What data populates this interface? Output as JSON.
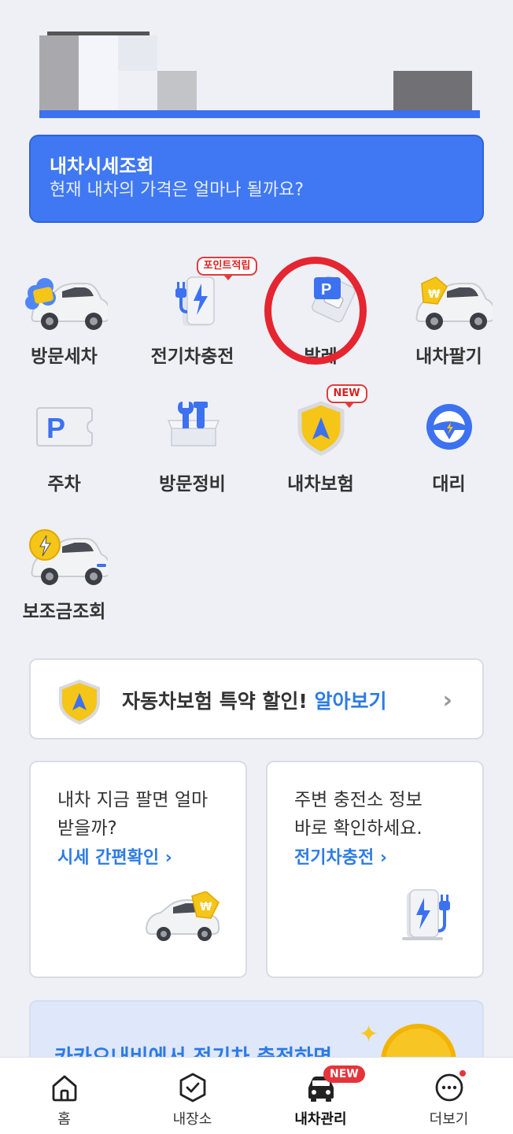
{
  "colors": {
    "accent": "#3f78f2",
    "link": "#2d7be5",
    "badge_red": "#e23b3b",
    "highlight_circle": "#e52530"
  },
  "banner": {
    "title": "내차시세조회",
    "subtitle": "현재 내차의 가격은 얼마나 될까요?"
  },
  "services": [
    {
      "label": "방문세차",
      "icon": "car-wash-icon"
    },
    {
      "label": "전기차충전",
      "icon": "ev-charger-icon",
      "badge": "포인트적립"
    },
    {
      "label": "발레",
      "icon": "valet-parking-icon"
    },
    {
      "label": "내차팔기",
      "icon": "car-sell-icon"
    },
    {
      "label": "주차",
      "icon": "parking-ticket-icon"
    },
    {
      "label": "방문정비",
      "icon": "toolbox-icon"
    },
    {
      "label": "내차보험",
      "icon": "insurance-shield-icon",
      "badge": "NEW"
    },
    {
      "label": "대리",
      "icon": "steering-wheel-icon"
    },
    {
      "label": "보조금조회",
      "icon": "ev-subsidy-icon"
    }
  ],
  "insurance": {
    "text": "자동차보험 특약 할인!",
    "link": "알아보기"
  },
  "cards": [
    {
      "line1": "내차 지금 팔면 얼마",
      "line2": "받을까?",
      "link": "시세 간편확인 ›"
    },
    {
      "line1": "주변 충전소 정보",
      "line2": "바로 확인하세요.",
      "link": "전기차충전 ›"
    }
  ],
  "promo": {
    "text": "카카오내비에서 전기차 충전하면"
  },
  "nav": {
    "items": [
      {
        "label": "홈",
        "icon": "home-icon"
      },
      {
        "label": "내장소",
        "icon": "my-places-icon"
      },
      {
        "label": "내차관리",
        "icon": "car-management-icon",
        "badge": "NEW",
        "active": true
      },
      {
        "label": "더보기",
        "icon": "more-icon"
      }
    ]
  }
}
